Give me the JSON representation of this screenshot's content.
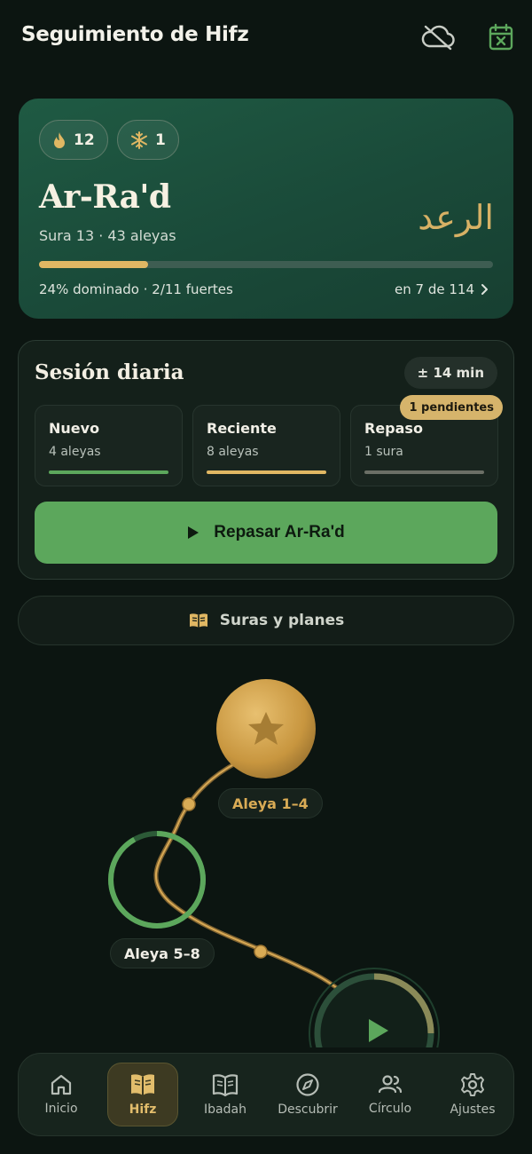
{
  "header": {
    "title": "Seguimiento de Hifz",
    "icons": [
      "cloud-off-icon",
      "calendar-x-icon"
    ]
  },
  "hero": {
    "streak_count": "12",
    "freeze_count": "1",
    "surah_name": "Ar-Ra'd",
    "surah_meta": "Sura 13 · 43 aleyas",
    "surah_arabic": "الرعد",
    "progress_fraction": 0.24,
    "stats": "24% dominado · 2/11 fuertes",
    "position": "en 7 de 114"
  },
  "session": {
    "title": "Sesión diaria",
    "duration": "± 14 min",
    "tiles": [
      {
        "title": "Nuevo",
        "sub": "4 aleyas",
        "color": "#5ca75c"
      },
      {
        "title": "Reciente",
        "sub": "8 aleyas",
        "color": "#e0b763"
      },
      {
        "title": "Repaso",
        "sub": "1 sura",
        "color": "#6b6f66",
        "badge": "1 pendientes"
      }
    ],
    "cta": "Repasar Ar-Ra'd"
  },
  "surahs_button": "Suras y planes",
  "map": {
    "nodes": [
      "Aleya 1–4",
      "Aleya 5–8"
    ]
  },
  "nav": {
    "items": [
      {
        "label": "Inicio",
        "icon": "home-icon"
      },
      {
        "label": "Hifz",
        "icon": "book-open-icon",
        "active": true
      },
      {
        "label": "Ibadah",
        "icon": "quran-book-icon"
      },
      {
        "label": "Descubrir",
        "icon": "compass-icon"
      },
      {
        "label": "Círculo",
        "icon": "people-icon"
      },
      {
        "label": "Ajustes",
        "icon": "gear-icon"
      }
    ]
  },
  "colors": {
    "accent_green": "#5ca75c",
    "accent_gold": "#e0b763",
    "background": "#0c1511"
  }
}
